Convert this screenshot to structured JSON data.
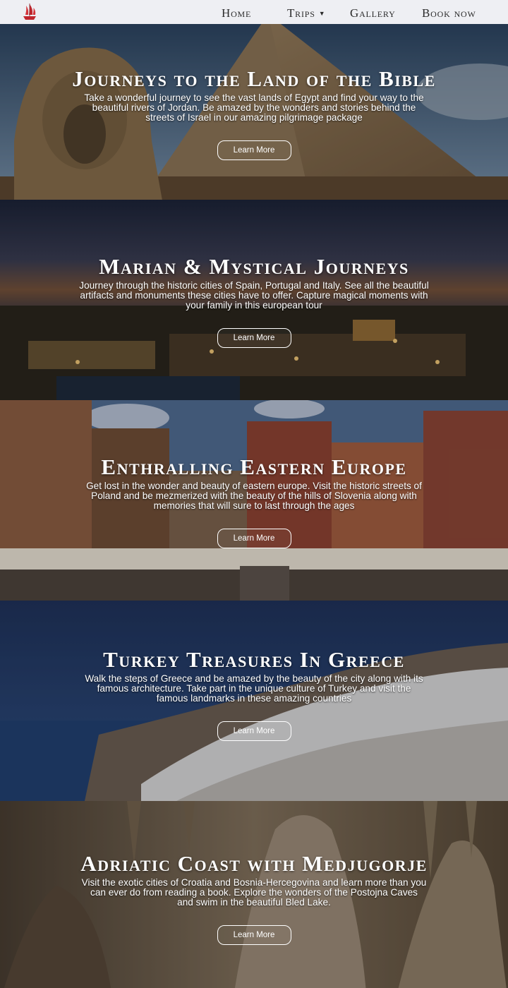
{
  "nav": {
    "logo_icon": "ship-logo-icon",
    "items": [
      {
        "label": "Home"
      },
      {
        "label": "Trips",
        "icon": "caret-down-icon"
      },
      {
        "label": "Gallery"
      },
      {
        "label": "Book now"
      }
    ]
  },
  "sections": [
    {
      "title": "Journeys to the Land of the Bible",
      "description": "Take a wonderful journey to see the vast lands of Egypt and find your way to the beautiful rivers of Jordan. Be amazed by the wonders and stories behind the streets of Israel in our amazing pilgrimage package",
      "button": "Learn More"
    },
    {
      "title": "Marian & Mystical Journeys",
      "description": "Journey through the historic cities of Spain, Portugal and Italy. See all the beautiful artifacts and monuments these cities have to offer. Capture magical moments with your family in this european tour",
      "button": "Learn More"
    },
    {
      "title": "Enthralling Eastern Europe",
      "description": "Get lost in the wonder and beauty of eastern europe. Visit the historic streets of Poland and be mezmerized with the beauty of the hills of Slovenia along with memories that will sure to last through the ages",
      "button": "Learn More"
    },
    {
      "title": "Turkey Treasures In Greece",
      "description": "Walk the steps of Greece and be amazed by the beauty of the city along with its famous architecture. Take part in the unique culture of Turkey and visit the famous landmarks in these amazing countries",
      "button": "Learn More"
    },
    {
      "title": "Adriatic Coast with Medjugorje",
      "description": "Visit the exotic cities of Croatia and Bosnia-Hercegovina and learn more than you can ever do from reading a book. Explore the wonders of the Postojna Caves and swim in the beautiful Bled Lake.",
      "button": "Learn More"
    }
  ]
}
